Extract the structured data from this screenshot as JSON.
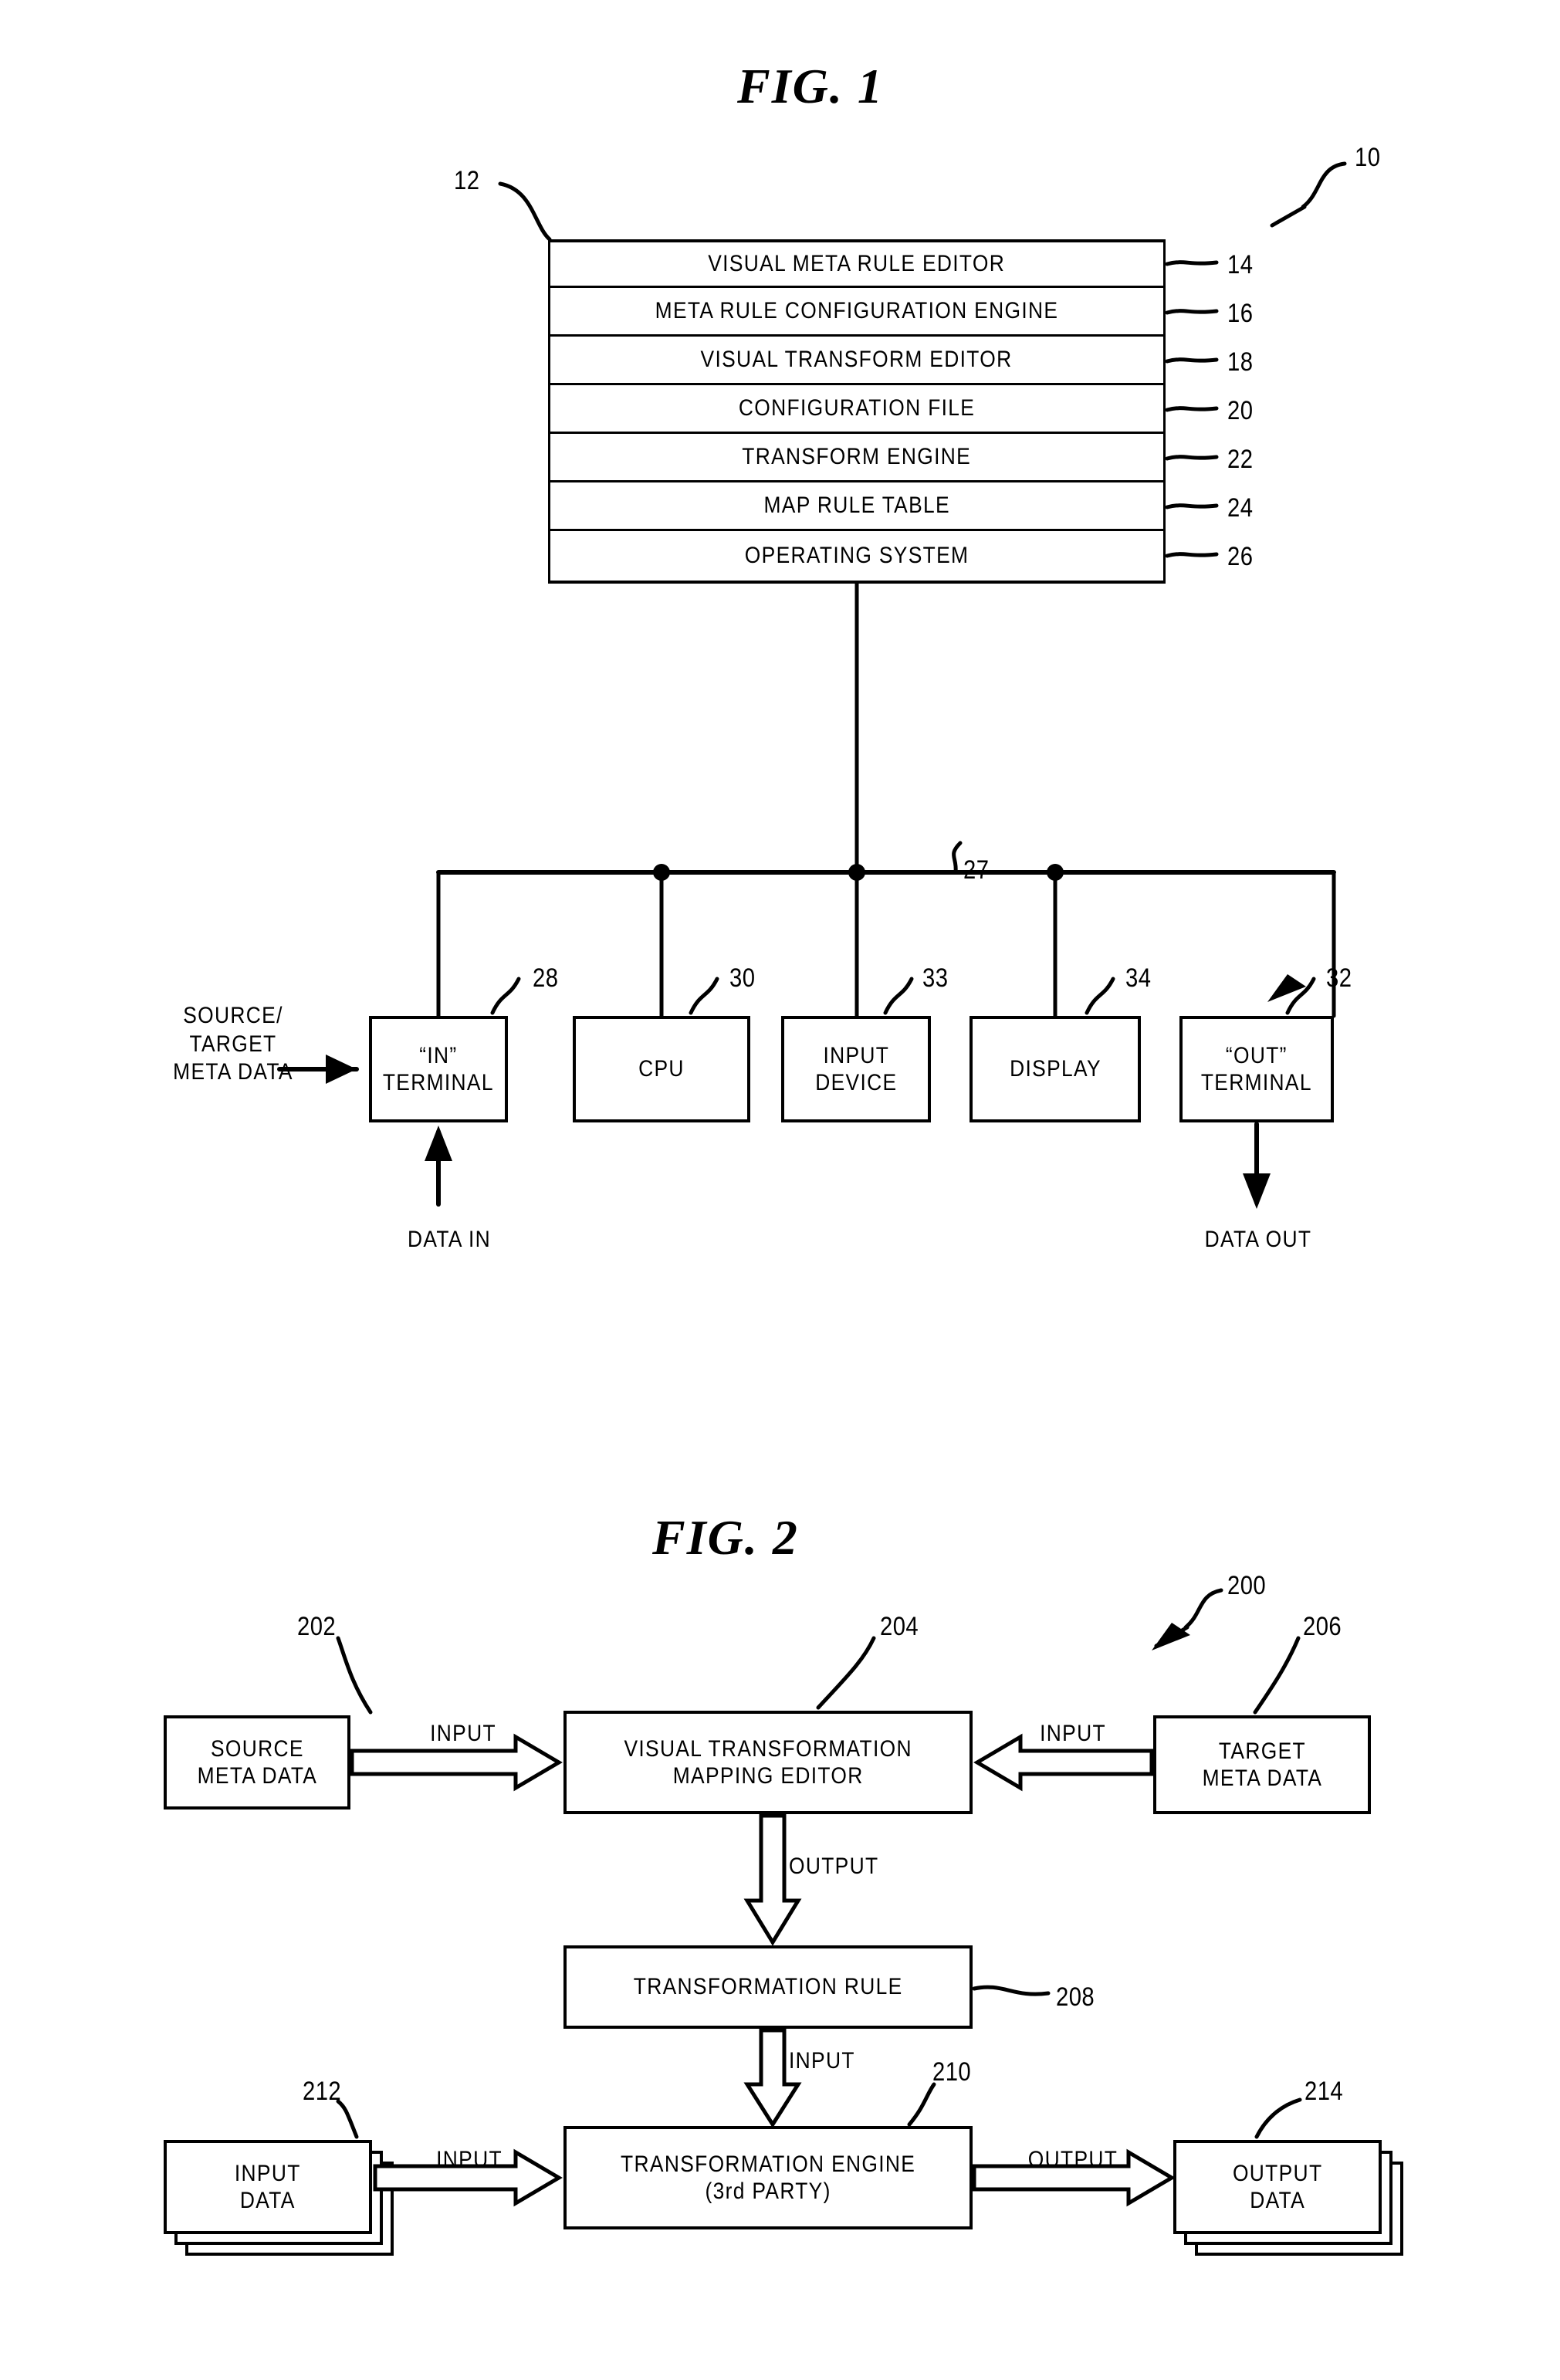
{
  "figures": [
    {
      "id": "fig1",
      "title": "FIG.  1",
      "system_ref": "10",
      "computer_ref": "12",
      "bus_ref": "27",
      "software_stack": [
        {
          "label": "VISUAL META RULE EDITOR",
          "ref": "14"
        },
        {
          "label": "META RULE CONFIGURATION ENGINE",
          "ref": "16"
        },
        {
          "label": "VISUAL TRANSFORM EDITOR",
          "ref": "18"
        },
        {
          "label": "CONFIGURATION FILE",
          "ref": "20"
        },
        {
          "label": "TRANSFORM ENGINE",
          "ref": "22"
        },
        {
          "label": "MAP RULE TABLE",
          "ref": "24"
        },
        {
          "label": "OPERATING SYSTEM",
          "ref": "26"
        }
      ],
      "hardware": [
        {
          "label": "“IN”\nTERMINAL",
          "ref": "28"
        },
        {
          "label": "CPU",
          "ref": "30"
        },
        {
          "label": "INPUT\nDEVICE",
          "ref": "33"
        },
        {
          "label": "DISPLAY",
          "ref": "34"
        },
        {
          "label": "“OUT”\nTERMINAL",
          "ref": "32"
        }
      ],
      "annotations": {
        "source_target": "SOURCE/\nTARGET\nMETA DATA",
        "data_in": "DATA IN",
        "data_out": "DATA OUT"
      }
    },
    {
      "id": "fig2",
      "title": "FIG.  2",
      "system_ref": "200",
      "nodes": [
        {
          "key": "source_meta",
          "label": "SOURCE\nMETA DATA",
          "ref": "202"
        },
        {
          "key": "editor",
          "label": "VISUAL TRANSFORMATION\nMAPPING EDITOR",
          "ref": "204"
        },
        {
          "key": "target_meta",
          "label": "TARGET\nMETA DATA",
          "ref": "206"
        },
        {
          "key": "rule",
          "label": "TRANSFORMATION RULE",
          "ref": "208"
        },
        {
          "key": "engine",
          "label": "TRANSFORMATION ENGINE\n(3rd PARTY)",
          "ref": "210"
        },
        {
          "key": "input_data",
          "label": "INPUT\nDATA",
          "ref": "212"
        },
        {
          "key": "output_data",
          "label": "OUTPUT\nDATA",
          "ref": "214"
        }
      ],
      "edge_labels": {
        "source_to_editor": "INPUT",
        "target_to_editor": "INPUT",
        "editor_to_rule": "OUTPUT",
        "rule_to_engine": "INPUT",
        "input_to_engine": "INPUT",
        "engine_to_output": "OUTPUT"
      }
    }
  ],
  "colors": {
    "ink": "#000000",
    "paper": "#ffffff"
  }
}
